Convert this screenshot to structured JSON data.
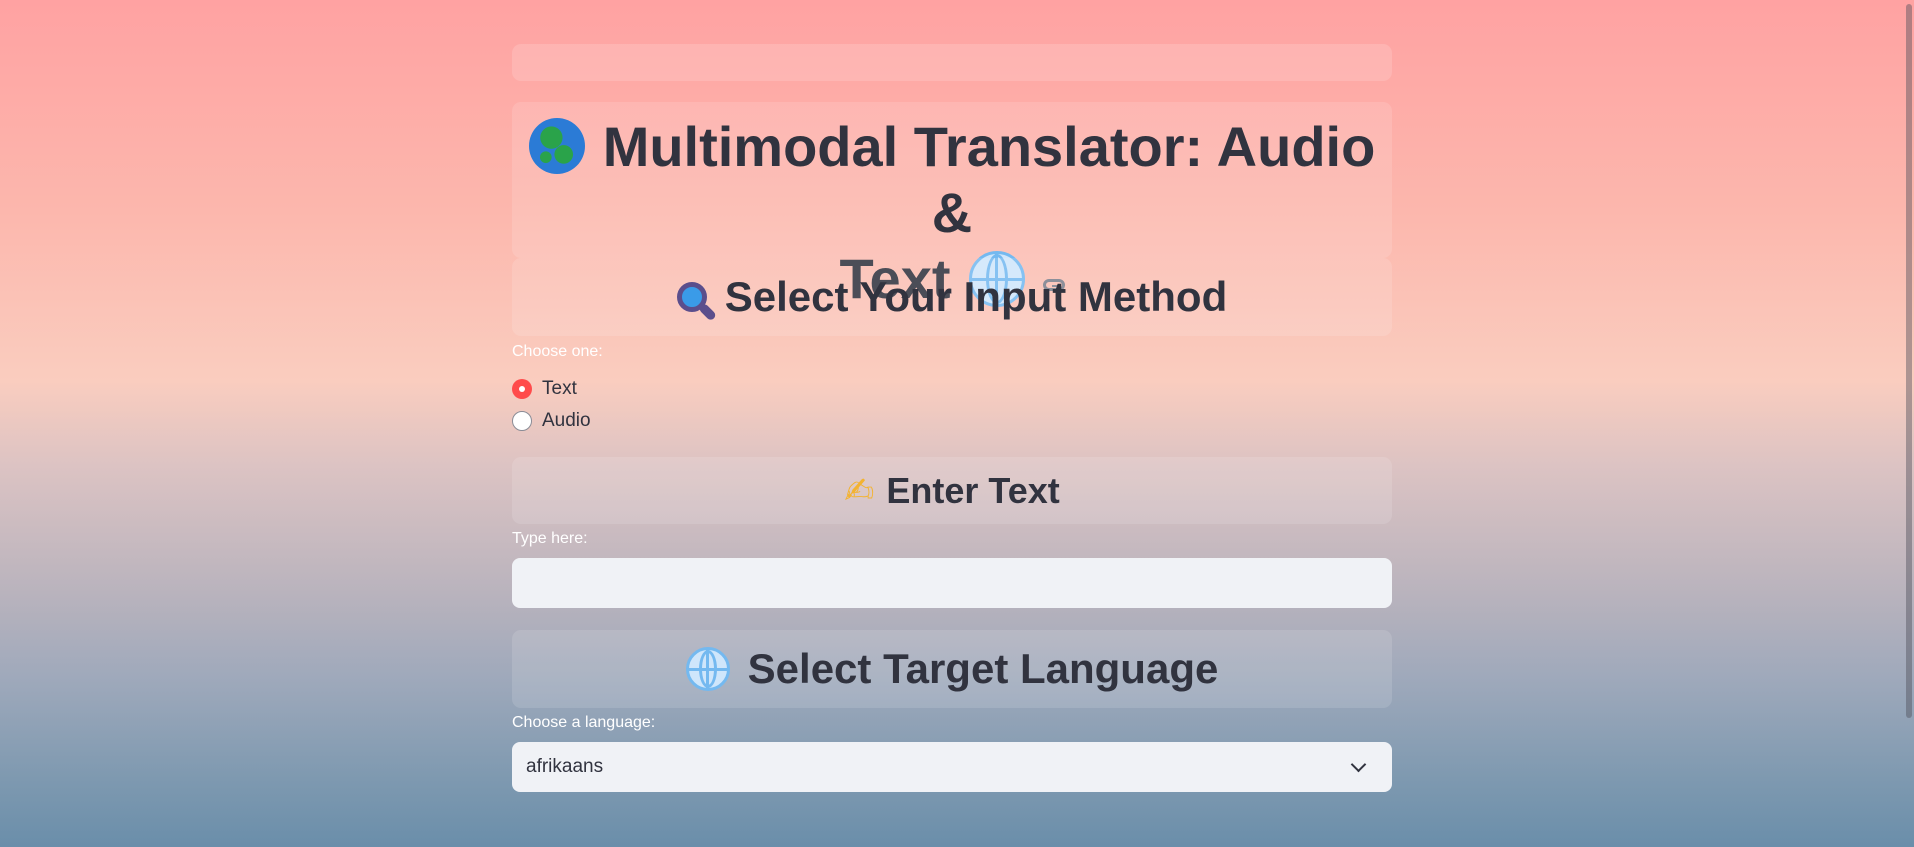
{
  "header": {
    "title_line1": "Multimodal Translator: Audio &",
    "title_line2": "Text"
  },
  "sections": {
    "input_method": "Select Your Input Method",
    "enter_text": "Enter Text",
    "target_language": "Select Target Language"
  },
  "input_method": {
    "label": "Choose one:",
    "options": [
      "Text",
      "Audio"
    ],
    "selected": "Text"
  },
  "text_input": {
    "label": "Type here:",
    "value": "",
    "placeholder": ""
  },
  "language_select": {
    "label": "Choose a language:",
    "selected": "afrikaans"
  },
  "icons": {
    "title_left": "globe-africa-icon",
    "title_right": "globe-meridians-icon",
    "anchor": "link-icon",
    "input_method": "magnifying-glass-icon",
    "enter_text": "writing-hand-icon",
    "target_language": "globe-meridians-icon"
  },
  "colors": {
    "accent": "#ff4b4b",
    "text": "#31333f",
    "input_bg": "#f0f2f6"
  }
}
